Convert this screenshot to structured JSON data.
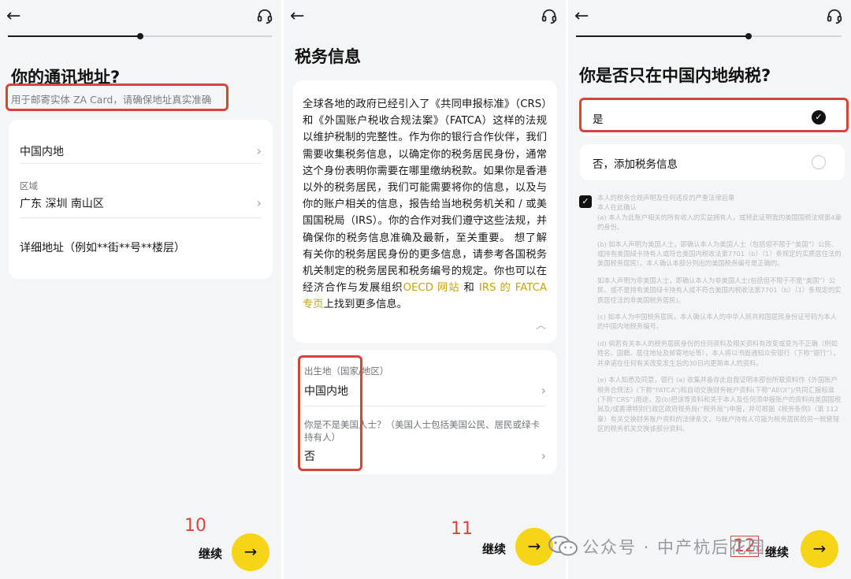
{
  "screen1": {
    "title": "你的通讯地址?",
    "subtitle": "用于邮寄实体 ZA Card，请确保地址真实准确",
    "region_country": "中国内地",
    "region_label": "区域",
    "region_value": "广东 深圳 南山区",
    "detail_placeholder": "详细地址（例如**街**号**楼层）",
    "step_number": "10",
    "continue_label": "继续",
    "progress": 0.5
  },
  "screen2": {
    "title": "税务信息",
    "body_1": "全球各地的政府已经引入了《共同申报标准》（CRS）和《外国账户税收合规法案》（FATCA）这样的法规以维护税制的完整性。作为你的银行合作伙伴，我们需要收集税务信息，以确定你的税务居民身份，通常这个身份表明你需要在哪里缴纳税款。如果你是香港以外的税务居民，我们可能需要将你的信息，以及与你的账户相关的信息，报告给当地税务机关和 / 或美国国税局（IRS）。你的合作对我们遵守这些法规，并确保你的税务信息准确及最新，至关重要。 想了解有关你的税务居民身份的更多信息，请参考各国税务机关制定的税务居民和税务编号的规定。你也可以在经济合作与发展组织",
    "link_1": "OECD 网站",
    "conj": "和",
    "link_2": "IRS 的 FATCA 专页",
    "body_2": "上找到更多信息。",
    "birthplace_label": "出生地（国家/地区）",
    "birthplace_value": "中国内地",
    "us_person_label": "你是不是美国人士？（美国人士包括美国公民、居民或绿卡持有人）",
    "us_person_value": "否",
    "step_number": "11",
    "continue_label": "继续",
    "progress": 0.9
  },
  "screen3": {
    "title": "你是否只在中国内地纳税?",
    "option_yes": "是",
    "option_no": "否，添加税务信息",
    "decl_1": "本人的税务合规声明及任何违反的严重法律后果",
    "decl_2": "本人在此确认",
    "decl_a": "(a) 本人为此账户相关的所有收入的实益拥有人，或特此证明我的美国国税法规第4章的身份。",
    "decl_b": "(b) 如本人声明为美国人士，即确认本人为美国人士（包括但不限于“美国”）公民、或持有美国绿卡持有人或符合美国内税收法第7701（b）（1）条规定的实质居住法的美国税务居民）。本人确认本部分列出的美国税务编号是正确的。",
    "decl_b2": "如本人声明为非美国人士，即确认本人为非美国人士(包括但不限于不是“美国”）公民、或不是持有美国绿卡持有人或不符合美国内税收法第7701（b）（1）条规定的实质居住法的非美国税务居民)。",
    "decl_c": "(c) 如本人为中国税务居民，本人确认本人的中华人民共和国居民身份证号码为本人的中国内地税务编号。",
    "decl_d": "(d) 倘若有关本人的税务居民身份的任何资料及相关资料有改变或变为不正确（例如姓名、国籍、居住地址及邮寄地址等），本人将以书面通知众安银行（下称“银行”），并承诺在任何有关改变发生后的30日内更新本人的资料。",
    "decl_e": "(e) 本人知悉及同意，银行 (a) 收集并备存此自我证明本部份所载资料作《外国账户税务合规法》(下称“FATCA”)和自动交换财务帐户资料(下称“AEOI”)/共同汇报标准(下称“CRS”)用途，及(b)把该等资料和关于本人及任何须申报账户的资料向美国国税局及/或香港特别行政区政府税务局(“税务局”)申报，并可根据《税务条例》（第 112 章）有关交换财务账户资料的法律条文，与账户持有人可能为税务居民的另一税管辖区的税务机关交换该部分资料。",
    "step_number": "12",
    "continue_label": "继续",
    "progress": 0.65
  },
  "icons": {
    "back": "back-arrow-icon",
    "support": "headset-icon",
    "chevron": "chevron-right-icon",
    "next": "arrow-right-icon",
    "check": "check-icon"
  },
  "watermark": {
    "text": "公众号 · 中产杭后花园"
  },
  "colors": {
    "accent": "#f6d417",
    "highlight": "#d9433b",
    "link": "#c9a106"
  }
}
